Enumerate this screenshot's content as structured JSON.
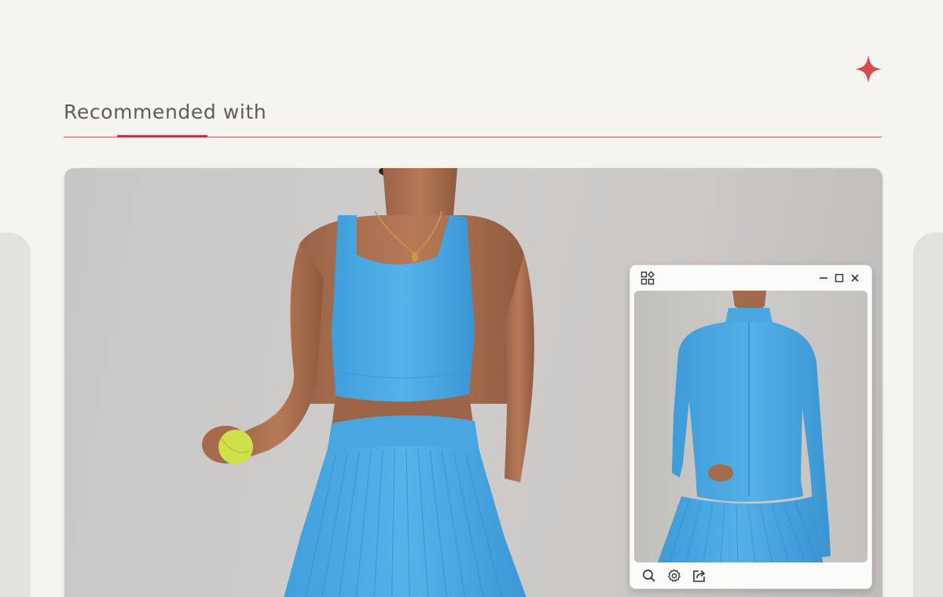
{
  "section": {
    "title": "Recommended with"
  },
  "colors": {
    "accent": "#c2303a",
    "background": "#f6f4f1",
    "garment_blue": "#4ba8e0"
  },
  "icons": {
    "sparkle": "sparkle-icon",
    "window_menu": "apps-grid-icon",
    "minimize": "minimize-icon",
    "maximize": "maximize-icon",
    "close": "close-icon",
    "search": "magnifier-icon",
    "settings": "gear-icon",
    "share": "share-icon"
  },
  "photo": {
    "subject": "Model in blue square-neck sports crop top and pleated tennis skirt holding a tennis ball"
  },
  "mini_window": {
    "subject": "Blue long-sleeve zip-up athletic jacket with pleated skirt"
  }
}
